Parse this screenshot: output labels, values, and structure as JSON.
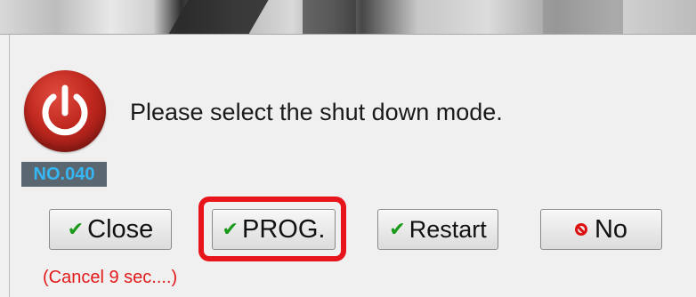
{
  "dialog": {
    "message": "Please select the shut down mode.",
    "code": "NO.040",
    "countdown": "(Cancel 9 sec....)"
  },
  "buttons": {
    "close": "Close",
    "prog": "PROG.",
    "restart": "Restart",
    "no": "No"
  },
  "icons": {
    "main": "power-icon",
    "check": "check-icon",
    "no": "no-entry-icon"
  },
  "colors": {
    "highlight": "#e8141c",
    "countdown": "#e21a1a",
    "check": "#1a9a1a",
    "power": "#c0281f",
    "badge_text": "#36b7f3"
  }
}
